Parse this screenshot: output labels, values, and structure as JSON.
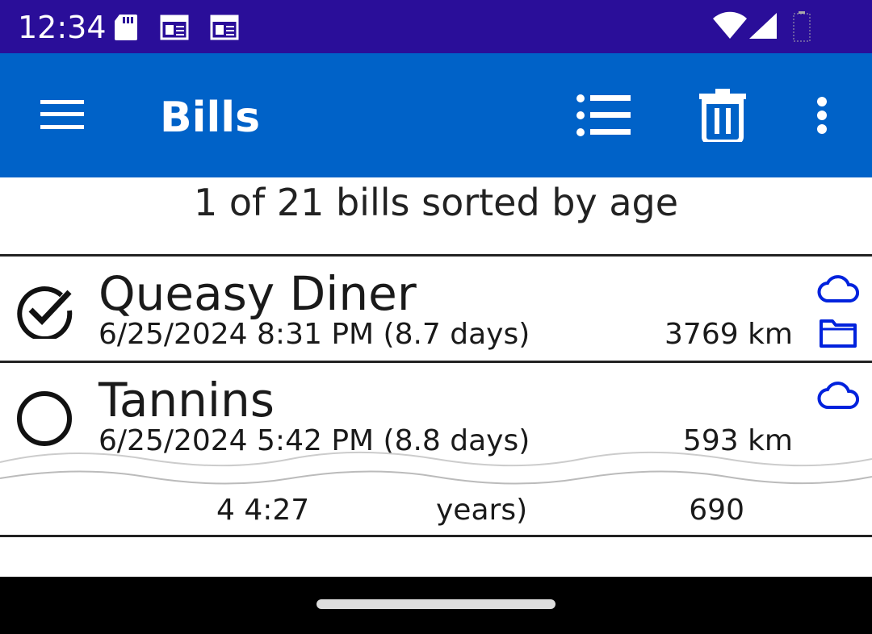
{
  "status_bar": {
    "time": "12:34"
  },
  "app_bar": {
    "title": "Bills"
  },
  "summary": "1 of 21 bills sorted by age",
  "bills": [
    {
      "name": "Queasy Diner",
      "date": "6/25/2024 8:31 PM (8.7 days)",
      "distance": "3769 km",
      "checked": true
    },
    {
      "name": "Tannins",
      "date": "6/25/2024 5:42 PM (8.8 days)",
      "distance": "593 km",
      "checked": false
    }
  ],
  "partial_row": {
    "date_fragment": "4 4:27",
    "date_fragment_2": "years)",
    "distance_fragment": "690"
  },
  "colors": {
    "status_bar": "#2a0e99",
    "app_bar": "#0062c8",
    "icon_blue": "#0022dd"
  }
}
